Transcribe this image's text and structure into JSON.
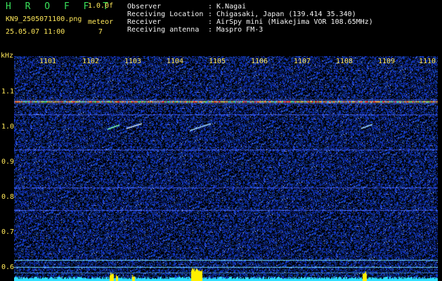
{
  "header": {
    "app_title": "H R O F F T",
    "version": "1.0.0f",
    "filename": "KN9_2505071100.png",
    "meteor_label": "meteor",
    "meteor_count": "7",
    "datetime": "25.05.07 11:00"
  },
  "info": {
    "observer_label": "Observer",
    "observer_value": ": K.Nagai",
    "location_label": "Receiving Location",
    "location_value": ": Chigasaki, Japan (139.414 35.340)",
    "receiver_label": "Receiver",
    "receiver_value": ": AirSpy mini (Miakejima VOR 108.65MHz)",
    "antenna_label": "Receiving antenna",
    "antenna_value": ": Maspro FM-3"
  },
  "axes": {
    "y_unit": "kHz",
    "y_ticks": [
      "1.1",
      "1.0",
      "0.9",
      "0.8",
      "0.7",
      "0.6"
    ],
    "x_ticks": [
      "1101",
      "1102",
      "1103",
      "1104",
      "1105",
      "1106",
      "1107",
      "1108",
      "1109",
      "1110"
    ]
  },
  "colors": {
    "background": "#000000",
    "noise": "#1a2fb0",
    "carrier": "#ff4a4a",
    "meteor": "#7dffb0",
    "baseline": "#2fe0ff",
    "burst": "#fff000",
    "text_yellow": "#ffe85a",
    "text_green": "#39e05a"
  }
}
